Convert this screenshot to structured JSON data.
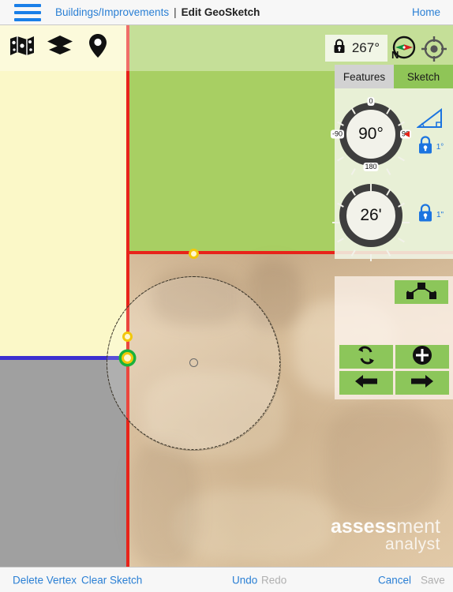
{
  "topnav": {
    "menu_icon": "hamburger-icon",
    "breadcrumb_parent": "Buildings/Improvements",
    "breadcrumb_separator": "|",
    "breadcrumb_current": "Edit GeoSketch",
    "home_label": "Home"
  },
  "map_toolbar": {
    "map_icon": "map-icon",
    "layers_icon": "layers-icon",
    "pin_icon": "map-pin-icon",
    "lock_icon": "lock-icon",
    "heading_value": "267°",
    "compass_icon": "compass-icon",
    "target_icon": "crosshair-target-icon"
  },
  "panel": {
    "tabs": [
      {
        "label": "Features",
        "active": true
      },
      {
        "label": "Sketch",
        "active": false
      }
    ],
    "angle_dial": {
      "value": "90°",
      "labels": {
        "top": "0",
        "left": "-90",
        "right": "90",
        "bottom": "180"
      },
      "triangle_icon": "right-triangle-angle-icon",
      "lock_icon": "lock-icon",
      "lock_unit": "1°"
    },
    "distance_dial": {
      "value": "26'",
      "lock_icon": "lock-icon",
      "lock_unit": "1\""
    },
    "buttons": [
      {
        "name": "node-network-button",
        "icon": "node-network-icon"
      },
      {
        "name": "flip-button",
        "icon": "flip-arrows-icon"
      },
      {
        "name": "add-vertex-button",
        "icon": "plus-circle-icon"
      },
      {
        "name": "previous-button",
        "icon": "arrow-left-icon"
      },
      {
        "name": "next-button",
        "icon": "arrow-right-icon"
      }
    ]
  },
  "watermark": {
    "brand_bold": "assess",
    "brand_light": "ment",
    "brand_sub": "analyst"
  },
  "bottombar": {
    "delete_vertex": "Delete Vertex",
    "clear_sketch": "Clear Sketch",
    "undo": "Undo",
    "redo": "Redo",
    "cancel": "Cancel",
    "save": "Save"
  },
  "colors": {
    "accent_blue": "#2a7fd4",
    "green_button": "#8cc65a",
    "red_line": "#e8231a",
    "blue_line": "#3b2fd0",
    "vertex_yellow": "#f2c80a",
    "vertex_active_green": "#19b23c",
    "parcel_yellow": "#fbf8c8",
    "parcel_gray": "#a0a0a0",
    "parcel_green": "#a8cf63",
    "parcel_tan": "#dcc09a"
  }
}
